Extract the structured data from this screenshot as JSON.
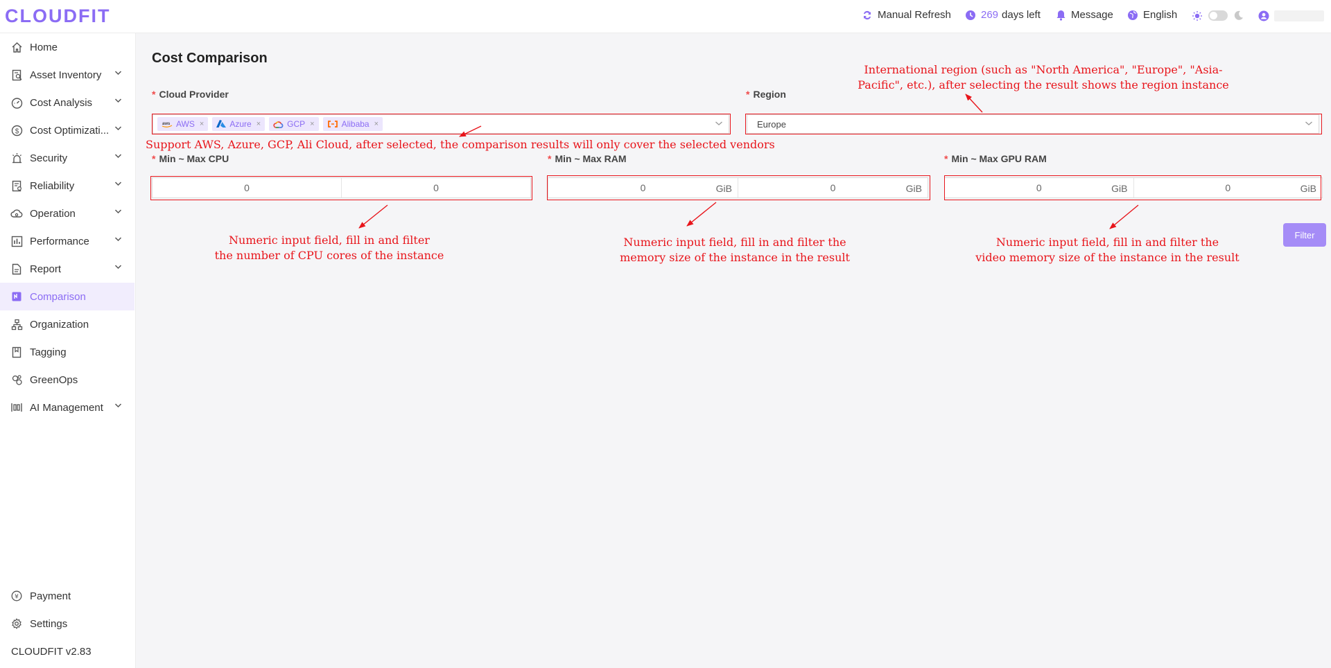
{
  "header": {
    "logo": "CLOUDFIT",
    "manual_refresh": "Manual Refresh",
    "days_left_number": "269",
    "days_left_suffix": "days left",
    "message": "Message",
    "language": "English"
  },
  "sidebar": {
    "items": [
      {
        "label": "Home",
        "icon": "home-icon",
        "has_chevron": false
      },
      {
        "label": "Asset Inventory",
        "icon": "asset-inventory-icon",
        "has_chevron": true
      },
      {
        "label": "Cost Analysis",
        "icon": "cost-analysis-icon",
        "has_chevron": true
      },
      {
        "label": "Cost Optimizati...",
        "icon": "dollar-icon",
        "has_chevron": true
      },
      {
        "label": "Security",
        "icon": "security-alarm-icon",
        "has_chevron": true
      },
      {
        "label": "Reliability",
        "icon": "reliability-icon",
        "has_chevron": true
      },
      {
        "label": "Operation",
        "icon": "cloud-operation-icon",
        "has_chevron": true
      },
      {
        "label": "Performance",
        "icon": "performance-icon",
        "has_chevron": true
      },
      {
        "label": "Report",
        "icon": "report-icon",
        "has_chevron": true
      },
      {
        "label": "Comparison",
        "icon": "comparison-icon",
        "has_chevron": false,
        "active": true
      },
      {
        "label": "Organization",
        "icon": "organization-icon",
        "has_chevron": false
      },
      {
        "label": "Tagging",
        "icon": "tag-icon",
        "has_chevron": false
      },
      {
        "label": "GreenOps",
        "icon": "greenops-icon",
        "has_chevron": false
      },
      {
        "label": "AI Management",
        "icon": "ai-management-icon",
        "has_chevron": true
      }
    ],
    "bottom_items": [
      {
        "label": "Payment",
        "icon": "yen-icon"
      },
      {
        "label": "Settings",
        "icon": "gear-icon"
      }
    ],
    "version": "CLOUDFIT v2.83"
  },
  "main": {
    "title": "Cost Comparison",
    "cloud_provider": {
      "label": "Cloud Provider",
      "required_mark": "*",
      "tags": [
        {
          "label": "AWS",
          "icon": "aws-icon"
        },
        {
          "label": "Azure",
          "icon": "azure-icon"
        },
        {
          "label": "GCP",
          "icon": "gcp-icon"
        },
        {
          "label": "Alibaba",
          "icon": "alibaba-icon"
        }
      ],
      "tag_remove": "×"
    },
    "region": {
      "label": "Region",
      "required_mark": "*",
      "value": "Europe"
    },
    "cpu": {
      "label": "Min ~ Max CPU",
      "required_mark": "*",
      "min": "0",
      "max": "0"
    },
    "ram": {
      "label": "Min ~ Max RAM",
      "required_mark": "*",
      "min": "0",
      "max": "0",
      "unit": "GiB"
    },
    "gpu_ram": {
      "label": "Min ~ Max GPU RAM",
      "required_mark": "*",
      "min": "0",
      "max": "0",
      "unit": "GiB"
    },
    "filter_button": "Filter"
  },
  "annotations": {
    "region_note_line1": "International region (such as \"North America\", \"Europe\", \"Asia-",
    "region_note_line2": "Pacific\", etc.), after selecting the result shows the region instance",
    "provider_note": "Support AWS, Azure, GCP, Ali Cloud, after selected, the comparison results will only cover the selected vendors",
    "cpu_note_line1": "Numeric input field, fill in and filter",
    "cpu_note_line2": "the number of CPU cores of the instance",
    "ram_note_line1": "Numeric input field, fill in and filter the",
    "ram_note_line2": "memory size of the instance in the result",
    "gpu_note_line1": "Numeric input field, fill in and filter the",
    "gpu_note_line2": "video memory size of the instance in the result",
    "color": "#e8151b"
  },
  "theme": {
    "accent": "#8b6cf4",
    "required": "#f04a4a"
  }
}
